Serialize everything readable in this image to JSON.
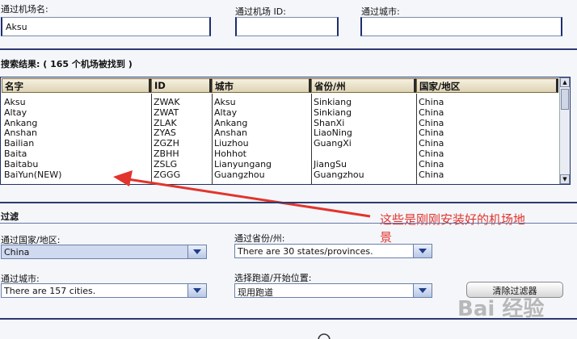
{
  "search": {
    "name_label": "通过机场名:",
    "name_value": "Aksu",
    "id_label": "通过机场 ID:",
    "id_value": "",
    "city_label": "通过城市:",
    "city_value": ""
  },
  "results": {
    "title": "搜索结果: ( 165 个机场被找到 )",
    "columns": [
      "名字",
      "ID",
      "城市",
      "省份/州",
      "国家/地区"
    ],
    "rows": [
      [
        "Aksu",
        "ZWAK",
        "Aksu",
        "Sinkiang",
        "China"
      ],
      [
        "Altay",
        "ZWAT",
        "Altay",
        "Sinkiang",
        "China"
      ],
      [
        "Ankang",
        "ZLAK",
        "Ankang",
        "ShanXi",
        "China"
      ],
      [
        "Anshan",
        "ZYAS",
        "Anshan",
        "LiaoNing",
        "China"
      ],
      [
        "Bailian",
        "ZGZH",
        "Liuzhou",
        "GuangXi",
        "China"
      ],
      [
        "Baita",
        "ZBHH",
        "Hohhot",
        "",
        "China"
      ],
      [
        "Baitabu",
        "ZSLG",
        "Lianyungang",
        "JiangSu",
        "China"
      ],
      [
        "BaiYun(NEW)",
        "ZGGG",
        "Guangzhou",
        "Guangzhou",
        "China"
      ]
    ]
  },
  "filter": {
    "title": "过滤",
    "country_label": "通过国家/地区:",
    "country_value": "China",
    "province_label": "通过省份/州:",
    "province_value": "There are 30 states/provinces.",
    "city_label": "通过城市:",
    "city_value": "There are 157 cities.",
    "runway_label": "选择跑道/开始位置:",
    "runway_value": "现用跑道",
    "clear_button": "清除过滤器"
  },
  "annotation": {
    "line1": "这些是刚刚安装好的机场地",
    "line2": "景"
  },
  "watermark": "Bai 经验",
  "colors": {
    "annotation": "#e2342c",
    "rule": "#2d3a6e",
    "header_bg": "#ddd3b5"
  }
}
